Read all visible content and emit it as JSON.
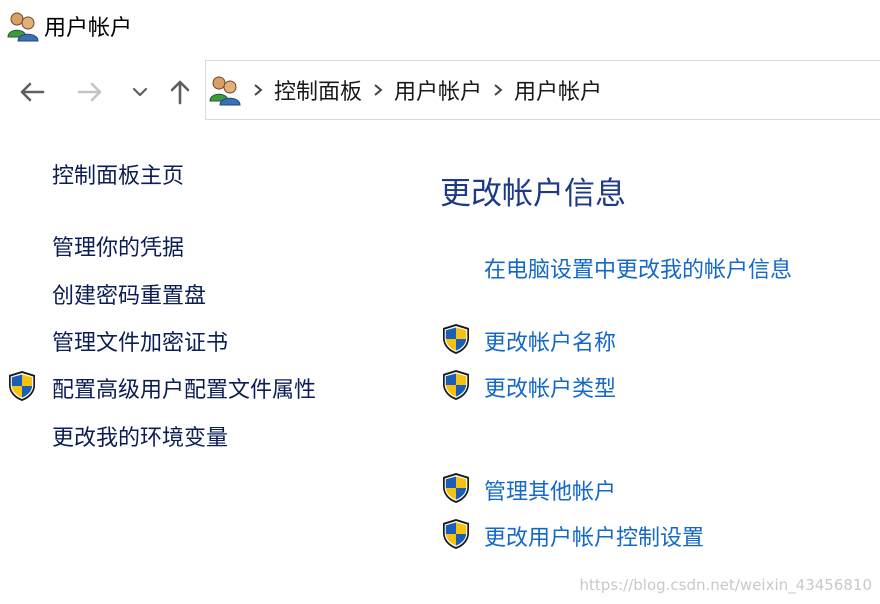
{
  "window": {
    "title": "用户帐户",
    "icon": "users-icon"
  },
  "navigation": {
    "back_icon": "back-arrow-icon",
    "forward_icon": "forward-arrow-icon",
    "recent_icon": "chevron-down-icon",
    "up_icon": "up-arrow-icon"
  },
  "address_bar": {
    "icon": "users-icon",
    "breadcrumbs": [
      "控制面板",
      "用户帐户",
      "用户帐户"
    ]
  },
  "left_pane": {
    "home_link": "控制面板主页",
    "links": [
      {
        "label": "管理你的凭据",
        "shield": false
      },
      {
        "label": "创建密码重置盘",
        "shield": false
      },
      {
        "label": "管理文件加密证书",
        "shield": false
      },
      {
        "label": "配置高级用户配置文件属性",
        "shield": true
      },
      {
        "label": "更改我的环境变量",
        "shield": false
      }
    ]
  },
  "main_pane": {
    "heading": "更改帐户信息",
    "links": [
      {
        "label": "在电脑设置中更改我的帐户信息",
        "shield": false
      },
      {
        "label": "更改帐户名称",
        "shield": true
      },
      {
        "label": "更改帐户类型",
        "shield": true
      },
      {
        "label": "管理其他帐户",
        "shield": true
      },
      {
        "label": "更改用户帐户控制设置",
        "shield": true
      }
    ]
  },
  "watermark": "https://blog.csdn.net/weixin_43456810",
  "colors": {
    "heading": "#1c3a87",
    "main_link": "#1468c8",
    "left_link": "#0b1d54",
    "shield_blue": "#1a5fb4",
    "shield_yellow": "#f5c211"
  }
}
